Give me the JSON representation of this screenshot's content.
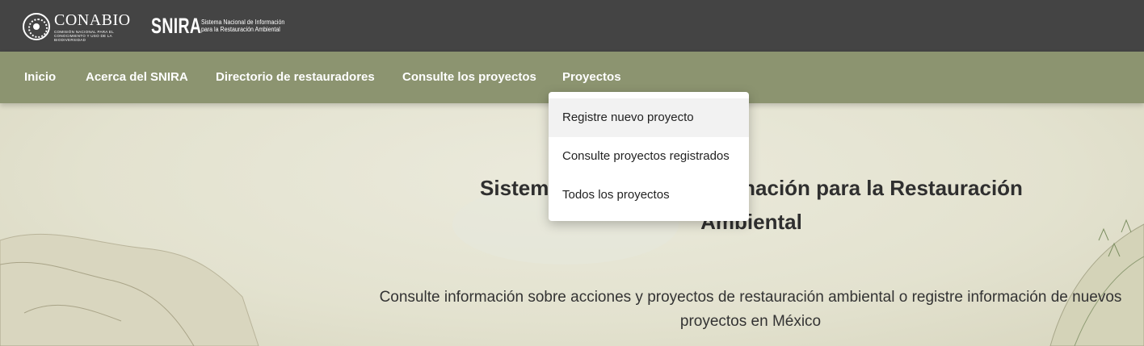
{
  "header": {
    "conabio": {
      "name": "CONABIO",
      "subtitle": "COMISIÓN NACIONAL PARA EL CONOCIMIENTO Y USO DE LA BIODIVERSIDAD"
    },
    "snira": {
      "name": "SNIRA",
      "subtitle_line1": "Sistema Nacional de Información",
      "subtitle_line2": "para la Restauración Ambiental"
    }
  },
  "nav": {
    "items": [
      {
        "label": "Inicio"
      },
      {
        "label": "Acerca del SNIRA"
      },
      {
        "label": "Directorio de restauradores"
      },
      {
        "label": "Consulte los proyectos"
      },
      {
        "label": "Proyectos"
      }
    ]
  },
  "dropdown": {
    "items": [
      {
        "label": "Registre nuevo proyecto",
        "highlighted": true
      },
      {
        "label": "Consulte proyectos registrados"
      },
      {
        "label": "Todos los proyectos"
      }
    ]
  },
  "hero": {
    "title": "Sistema Nacional de Información para la Restauración Ambiental",
    "description": "Consulte información sobre acciones y proyectos de restauración ambiental o registre información de nuevos proyectos en México"
  },
  "colors": {
    "topbar": "#444444",
    "navbar": "#8c9470",
    "dropdown_bg": "#ffffff",
    "dropdown_highlight": "#f2f2f2"
  }
}
